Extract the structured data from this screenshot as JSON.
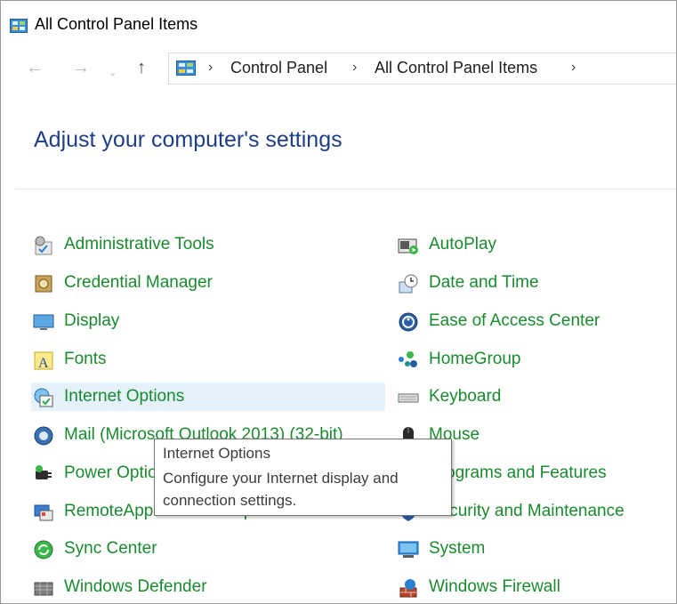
{
  "window": {
    "title": "All Control Panel Items"
  },
  "nav": {
    "back": "←",
    "forward": "→",
    "recent": "⌄",
    "up": "↑",
    "separator": "›",
    "breadcrumbs": [
      "Control Panel",
      "All Control Panel Items"
    ]
  },
  "header": {
    "title": "Adjust your computer's settings"
  },
  "items_left": [
    {
      "label": "Administrative Tools",
      "icon": "administrative-tools-icon"
    },
    {
      "label": "Credential Manager",
      "icon": "credential-manager-icon"
    },
    {
      "label": "Display",
      "icon": "display-icon"
    },
    {
      "label": "Fonts",
      "icon": "fonts-icon"
    },
    {
      "label": "Internet Options",
      "icon": "internet-options-icon"
    },
    {
      "label": "Mail (Microsoft Outlook 2013) (32-bit)",
      "icon": "mail-icon"
    },
    {
      "label": "Power Options",
      "icon": "power-options-icon"
    },
    {
      "label": "RemoteApp and Desktop Connections",
      "icon": "remoteapp-icon"
    },
    {
      "label": "Sync Center",
      "icon": "sync-center-icon"
    },
    {
      "label": "Windows Defender",
      "icon": "windows-defender-icon"
    }
  ],
  "items_right": [
    {
      "label": "AutoPlay",
      "icon": "autoplay-icon"
    },
    {
      "label": "Date and Time",
      "icon": "date-time-icon"
    },
    {
      "label": "Ease of Access Center",
      "icon": "ease-of-access-icon"
    },
    {
      "label": "HomeGroup",
      "icon": "homegroup-icon"
    },
    {
      "label": "Keyboard",
      "icon": "keyboard-icon"
    },
    {
      "label": "Mouse",
      "icon": "mouse-icon"
    },
    {
      "label": "Programs and Features",
      "icon": "programs-features-icon"
    },
    {
      "label": "Security and Maintenance",
      "icon": "security-maintenance-icon"
    },
    {
      "label": "System",
      "icon": "system-icon"
    },
    {
      "label": "Windows Firewall",
      "icon": "windows-firewall-icon"
    }
  ],
  "tooltip": {
    "title": "Internet Options",
    "description": "Configure your Internet display and connection settings."
  },
  "colors": {
    "link": "#1a8a2e",
    "title": "#1e3f87",
    "hover": "#e5f1fb"
  }
}
